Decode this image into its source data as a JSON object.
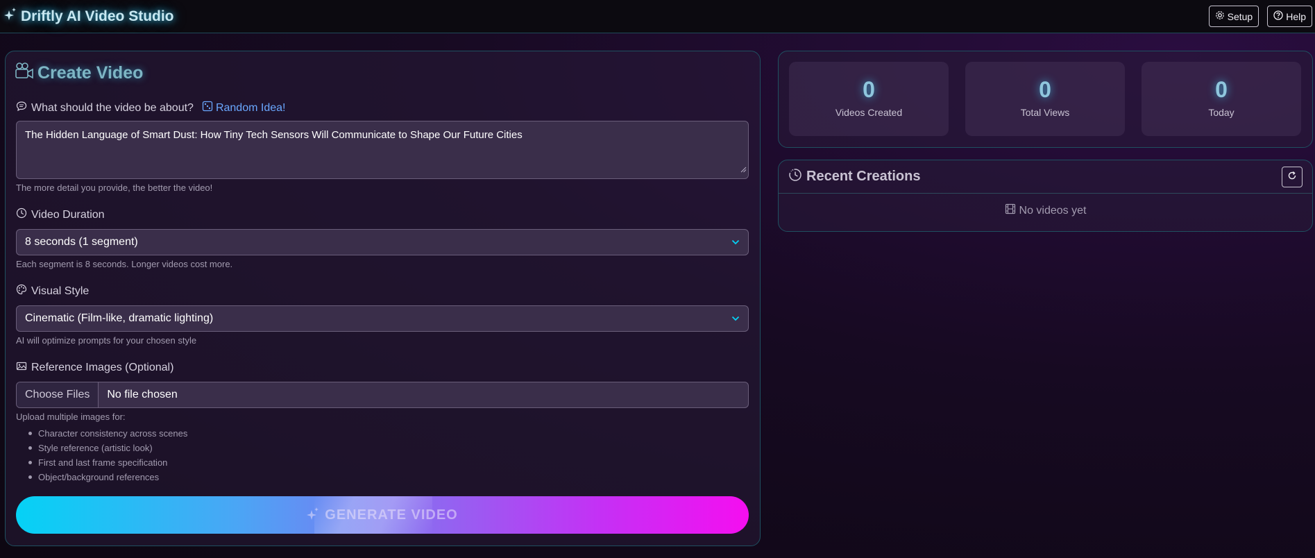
{
  "header": {
    "title": "Driftly AI Video Studio",
    "setup_label": "Setup",
    "help_label": "Help"
  },
  "create": {
    "title": "Create Video",
    "prompt_label": "What should the video be about?",
    "random_idea_label": "Random Idea!",
    "prompt_value": "The Hidden Language of Smart Dust: How Tiny Tech Sensors Will Communicate to Shape Our Future Cities",
    "prompt_hint": "The more detail you provide, the better the video!",
    "duration_label": "Video Duration",
    "duration_value": "8 seconds (1 segment)",
    "duration_hint": "Each segment is 8 seconds. Longer videos cost more.",
    "style_label": "Visual Style",
    "style_value": "Cinematic (Film-like, dramatic lighting)",
    "style_hint": "AI will optimize prompts for your chosen style",
    "reference_label": "Reference Images (Optional)",
    "choose_files_label": "Choose Files",
    "file_status": "No file chosen",
    "upload_hint": "Upload multiple images for:",
    "upload_uses": [
      "Character consistency across scenes",
      "Style reference (artistic look)",
      "First and last frame specification",
      "Object/background references"
    ],
    "generate_label": "GENERATE VIDEO"
  },
  "stats": [
    {
      "value": "0",
      "label": "Videos Created"
    },
    {
      "value": "0",
      "label": "Total Views"
    },
    {
      "value": "0",
      "label": "Today"
    }
  ],
  "recent": {
    "title": "Recent Creations",
    "empty_text": "No videos yet"
  },
  "colors": {
    "accent_cyan": "#05d2f5",
    "accent_magenta": "#f50ef0",
    "link_blue": "#6aa8ff"
  }
}
